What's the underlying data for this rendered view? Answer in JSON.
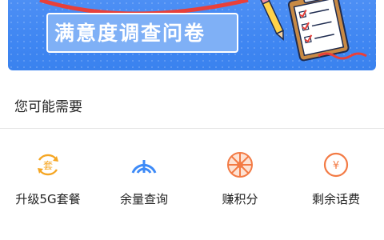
{
  "banner": {
    "title": "满意度调查问卷"
  },
  "section": {
    "title": "您可能需要"
  },
  "services": [
    {
      "label": "升级5G套餐",
      "icon": "package-upgrade-icon",
      "icon_text": "套",
      "color": "#f5a623"
    },
    {
      "label": "余量查询",
      "icon": "signal-gauge-icon",
      "color": "#3d8af7"
    },
    {
      "label": "赚积分",
      "icon": "points-wheel-icon",
      "color": "#f37b45"
    },
    {
      "label": "剩余话费",
      "icon": "balance-coin-icon",
      "icon_text": "¥",
      "color": "#f37b45"
    }
  ]
}
